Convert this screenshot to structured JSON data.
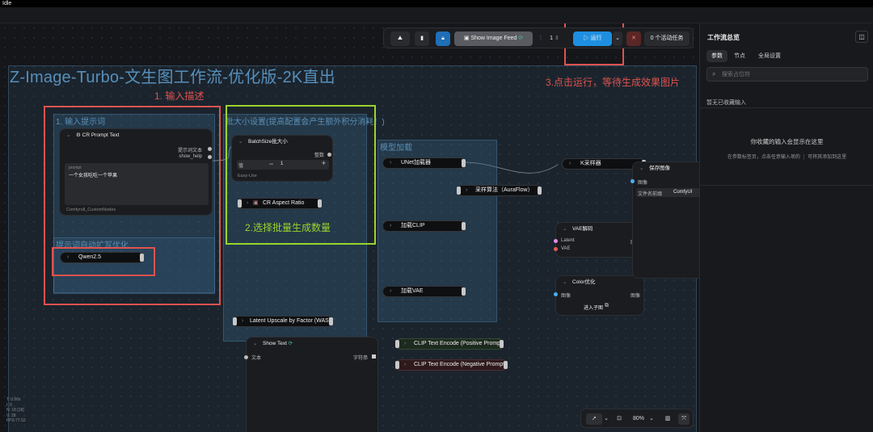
{
  "window": {
    "title": "Idle"
  },
  "workflow": {
    "title": "Z-Image-Turbo-文生图工作流-优化版-2K直出"
  },
  "toolbar": {
    "show_image_feed": "Show Image Feed",
    "batch_count": "1",
    "run_label": "运行",
    "active_tasks": "0 个活动任务"
  },
  "annotations": {
    "step1": "1. 输入描述",
    "step2": "2.选择批量生成数量",
    "step3": "3.点击运行，等待生成效果图片"
  },
  "groups": {
    "input_prompt": "1. 输入提示词",
    "prompt_expand": "提示词自动扩写优化",
    "size_settings": "批大小设置(提高配置会产生额外积分消耗！)",
    "model_load": "模型加载"
  },
  "nodes": {
    "cr_prompt": {
      "title": "CR Prompt Text",
      "out1": "提示词文本",
      "out2": "show_help",
      "field_label": "prompt",
      "field_value": "一个女孩吃吃一个苹果",
      "footer": "Comfyroll_CustomNodes"
    },
    "qwen": "Qwen2.5",
    "batchsize": {
      "title": "BatchSize批大小",
      "out": "整数",
      "value_label": "值",
      "value": "1",
      "footer": "Easy-Use"
    },
    "aspect": "CR Aspect Ratio",
    "unet": "UNet加载器",
    "sampling": "采样算法（AuraFlow）",
    "clip": "加载CLIP",
    "vae": "加载VAE",
    "ksampler": "K采样器",
    "vae_decode": {
      "title": "VAE解码",
      "in1": "Latent",
      "in2": "VAE",
      "out": "图像"
    },
    "color": {
      "title": "Color优化",
      "in": "图像",
      "out": "图像",
      "sub": "进入子图"
    },
    "save": {
      "title": "保存图像",
      "in": "图像",
      "field_label": "文件名前缀",
      "field_value": "ComfyUI"
    },
    "upscale": "Latent Upscale by Factor (WAS)",
    "show_text": {
      "title": "Show Text",
      "in": "文本",
      "out": "字符串"
    },
    "clip_pos": "CLIP Text Encode (Positive Prompt)",
    "clip_neg": "CLIP Text Encode (Negative Prompt)"
  },
  "right_panel": {
    "title": "工作流总览",
    "tabs": [
      "参数",
      "节点",
      "全局设置"
    ],
    "search_placeholder": "搜索占位符",
    "section": "暂无已收藏输入",
    "empty_title": "你收藏的输入会显示在这里",
    "empty_desc": "在参数标签页，点击任意输入项的 ⋮ 可将其添加到这里"
  },
  "stats": [
    "T: 0.00s",
    "I: 0",
    "N: 18 [18]",
    "V: 28",
    "FPS:77.52"
  ],
  "zoom": {
    "value": "80%"
  },
  "colors": {
    "accent": "#1e8fe0",
    "annotation_red": "#e0524f",
    "annotation_green": "#9ad42c",
    "group": "#3c6e96"
  }
}
